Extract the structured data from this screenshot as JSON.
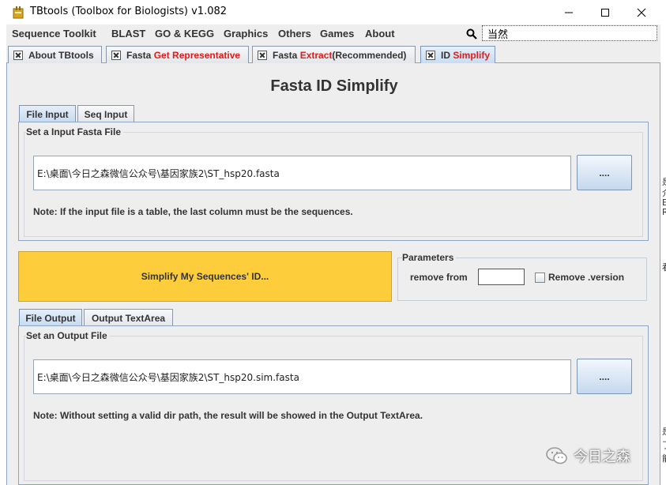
{
  "window": {
    "title": "TBtools (Toolbox for Biologists) v1.082",
    "icon": "app-icon",
    "controls": [
      "minimize",
      "maximize",
      "close"
    ]
  },
  "menubar": {
    "items": [
      "Sequence Toolkit",
      "BLAST",
      "GO & KEGG",
      "Graphics",
      "Others",
      "Games",
      "About"
    ],
    "search_icon": "search-icon",
    "search_value": "当然"
  },
  "tabs": [
    {
      "pre": "About TBtools",
      "highlight": "",
      "post": ""
    },
    {
      "pre": "Fasta ",
      "highlight": "Get Representative",
      "post": ""
    },
    {
      "pre": "Fasta ",
      "highlight": "Extract",
      "post": " (Recommended)"
    },
    {
      "pre": "ID ",
      "highlight": "Simplify",
      "post": ""
    }
  ],
  "main": {
    "title": "Fasta ID Simplify",
    "input_tabs": [
      "File Input",
      "Seq Input"
    ],
    "input_group_title": "Set a Input Fasta File",
    "input_path": "E:\\桌面\\今日之森微信公众号\\基因家族2\\ST_hsp20.fasta",
    "browse_label": "....",
    "input_note": "Note: If the input file is a table, the last column must be the sequences.",
    "run_button": "Simplify My Sequences' ID...",
    "params_title": "Parameters",
    "remove_from_label": "remove from",
    "remove_from_value": "",
    "remove_version_label": "Remove .version",
    "remove_version_checked": false,
    "output_tabs": [
      "File Output",
      "Output TextArea"
    ],
    "output_group_title": "Set an Output File",
    "output_path": "E:\\桌面\\今日之森微信公众号\\基因家族2\\ST_hsp20.sim.fasta",
    "output_note": "Note: Without setting a valid dir path, the result will be showed in the Output TextArea."
  },
  "background_fragments": [
    "是",
    "介",
    "E",
    "Re",
    "看",
    "是",
    "了",
    "能"
  ],
  "watermark": "今日之森",
  "colors": {
    "run_button": "#fdcd3c",
    "highlight_text": "#e21c1c",
    "active_tab": "#c9dcf0",
    "panel": "#eeeeee"
  }
}
